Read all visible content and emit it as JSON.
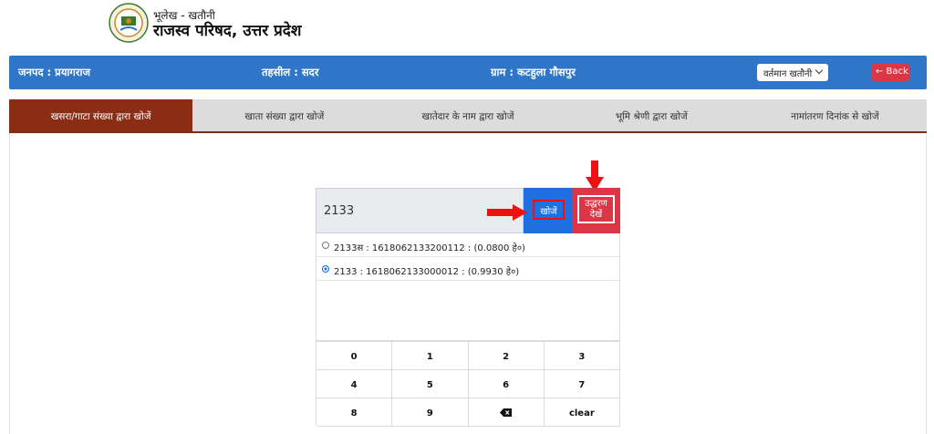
{
  "header": {
    "subtitle": "भूलेख - खतौनी",
    "title": "राजस्व परिषद, उत्तर प्रदेश"
  },
  "infobar": {
    "district": "जनपद : प्रयागराज",
    "tehsil": "तहसील : सदर",
    "village": "ग्राम : कटहुला गौसपुर",
    "khatauni_select": "वर्तमान खतौनी",
    "back_label": "← Back"
  },
  "tabs": [
    {
      "label": "खसरा/गाटा संख्या द्वारा खोजें",
      "active": true
    },
    {
      "label": "खाता संख्या द्वारा खोजें",
      "active": false
    },
    {
      "label": "खातेदार के नाम द्वारा खोजें",
      "active": false
    },
    {
      "label": "भूमि श्रेणी द्वारा खोजें",
      "active": false
    },
    {
      "label": "नामांतरण दिनांक से खोजें",
      "active": false
    }
  ],
  "search": {
    "value": "2133",
    "search_label": "खोजें",
    "extract_label_line1": "उद्धरण",
    "extract_label_line2": "देखें"
  },
  "results": [
    {
      "text": "2133स : 1618062133200112 : (0.0800 हे०)",
      "selected": false
    },
    {
      "text": "2133 : 1618062133000012 : (0.9930 हे०)",
      "selected": true
    }
  ],
  "keypad": {
    "k0": "0",
    "k1": "1",
    "k2": "2",
    "k3": "3",
    "k4": "4",
    "k5": "5",
    "k6": "6",
    "k7": "7",
    "k8": "8",
    "k9": "9",
    "clear": "clear"
  },
  "colors": {
    "infobar": "#2f76c9",
    "active_tab": "#8b2d14",
    "search_button": "#1f6fe0",
    "extract_button": "#dc3545",
    "annotation_arrow": "#ee1111"
  }
}
